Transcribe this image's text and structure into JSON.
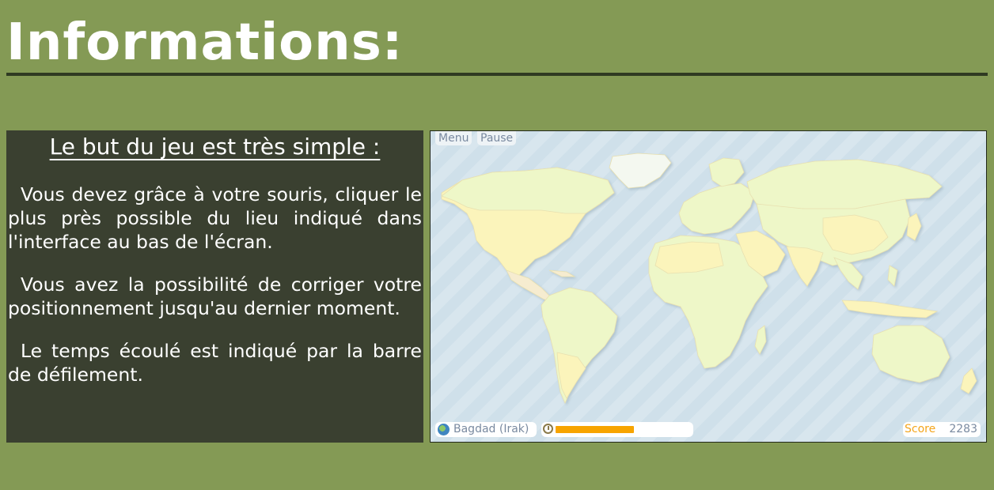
{
  "page": {
    "title": "Informations:"
  },
  "info": {
    "heading": "Le but du jeu est très simple :",
    "paragraphs": [
      "Vous devez grâce à votre souris, cliquer le plus près possible du lieu indiqué dans l'interface au bas de l'écran.",
      "Vous avez la possibilité de corriger votre positionnement jusqu'au dernier moment.",
      "Le temps écoulé est indiqué par la barre de défilement."
    ]
  },
  "game": {
    "menu_label": "Menu",
    "pause_label": "Pause",
    "target_place": "Bagdad (Irak)",
    "timer_progress": 0.58,
    "score_label": "Score",
    "score_value": "2283",
    "icons": [
      "globe-icon",
      "clock-icon"
    ],
    "colors": {
      "timer_fill": "#f7a400",
      "score_label": "#f4a51c",
      "ocean": "#d3e3ec",
      "land_green": "#eef7c8",
      "land_yellow": "#fbf4bb"
    }
  }
}
